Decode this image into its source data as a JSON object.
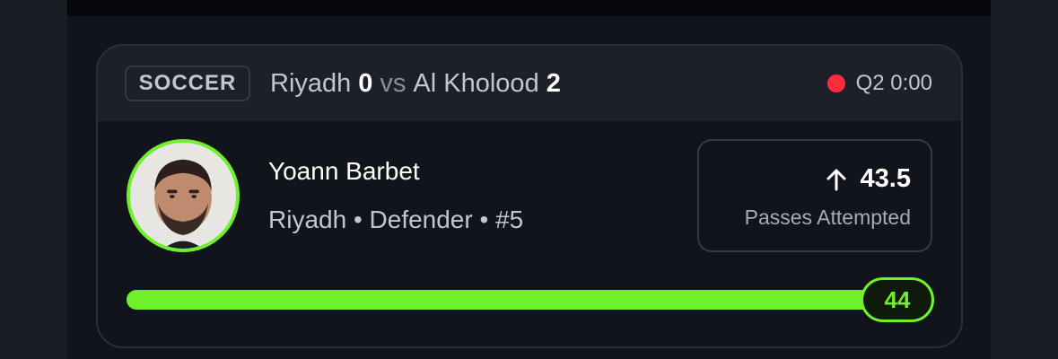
{
  "header": {
    "sport": "SOCCER",
    "home_team": "Riyadh",
    "home_score": "0",
    "vs": "vs",
    "away_team": "Al Kholood",
    "away_score": "2",
    "period": "Q2 0:00",
    "live_color": "#ff2c3e"
  },
  "player": {
    "name": "Yoann Barbet",
    "team": "Riyadh",
    "position": "Defender",
    "number": "#5",
    "meta": "Riyadh • Defender • #5",
    "avatar_icon": "player-avatar"
  },
  "projection": {
    "direction_icon": "arrow-up-icon",
    "line": "43.5",
    "stat": "Passes Attempted"
  },
  "progress": {
    "current": "44",
    "fraction": 1.0,
    "color": "#6ff02c"
  }
}
